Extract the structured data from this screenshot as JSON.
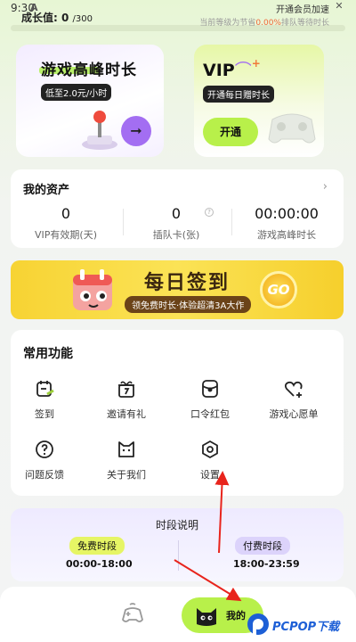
{
  "status": {
    "time": "9:30",
    "a_label": "A"
  },
  "growth": {
    "label": "成长值:",
    "value": "0",
    "max": "/300",
    "progress": 0
  },
  "header": {
    "open_vip": "开通会员加速",
    "close": "✕",
    "level_text": "当前等级为节省",
    "level_pct": "0.00%",
    "level_suffix": "排队等待时长"
  },
  "game_card": {
    "title": "游戏高峰时长",
    "subtitle": "低至2.0元/小时",
    "arrow_icon": "arrow-right-icon"
  },
  "vip_card": {
    "title": "VIP",
    "subtitle": "开通每日赠时长",
    "button": "开通"
  },
  "assets": {
    "title": "我的资产",
    "items": [
      {
        "value": "0",
        "label": "VIP有效期(天)"
      },
      {
        "value": "0",
        "label": "插队卡(张)"
      },
      {
        "value": "00:00:00",
        "label": "游戏高峰时长"
      }
    ]
  },
  "banner": {
    "title": "每日签到",
    "subtitle": "领免费时长·体验超清3A大作",
    "go": "GO"
  },
  "functions": {
    "title": "常用功能",
    "items": [
      {
        "label": "签到",
        "icon": "calendar-check-icon"
      },
      {
        "label": "邀请有礼",
        "icon": "gift-icon"
      },
      {
        "label": "口令红包",
        "icon": "red-packet-icon"
      },
      {
        "label": "游戏心愿单",
        "icon": "heart-plus-icon"
      },
      {
        "label": "问题反馈",
        "icon": "question-icon"
      },
      {
        "label": "关于我们",
        "icon": "cat-face-icon"
      },
      {
        "label": "设置",
        "icon": "settings-hex-icon"
      }
    ]
  },
  "time_section": {
    "title": "时段说明",
    "free_label": "免费时段",
    "free_time": "00:00-18:00",
    "paid_label": "付费时段",
    "paid_time": "18:00-23:59"
  },
  "nav": {
    "mine_label": "我的"
  },
  "watermark": {
    "text": "PCPOP下载"
  },
  "colors": {
    "accent_green": "#b8f04a",
    "accent_purple": "#a36ef2",
    "banner_yellow": "#f7d333",
    "annotation_red": "#e8241c"
  }
}
